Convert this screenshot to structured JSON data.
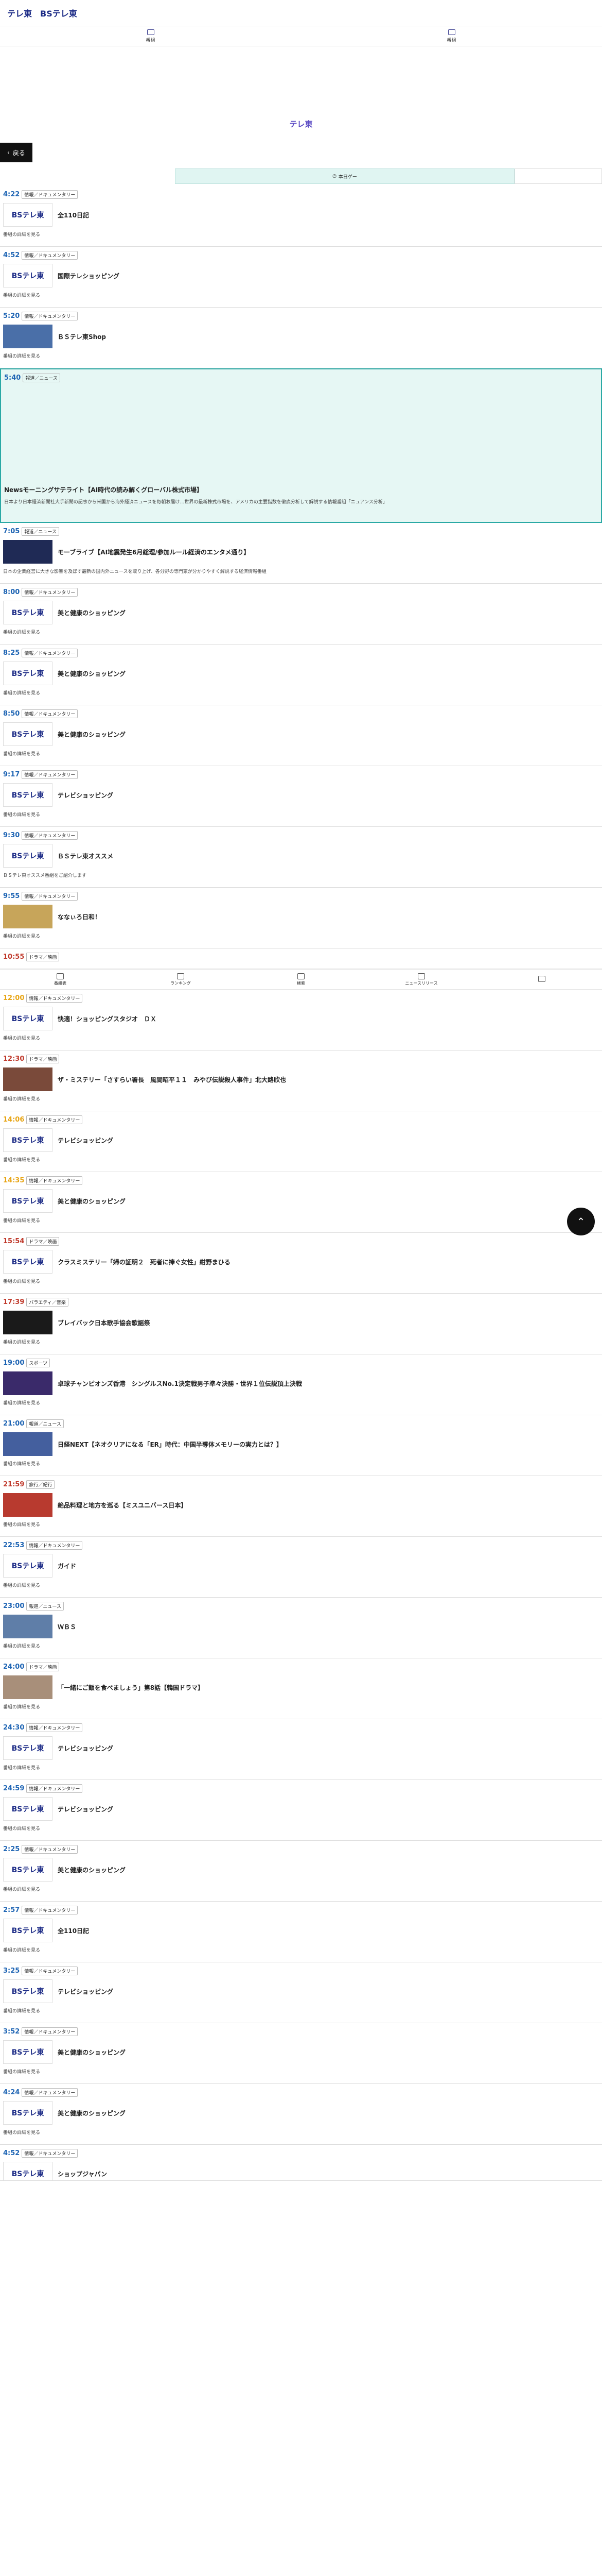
{
  "header": {
    "logo1": "テレ東",
    "logo2": "BSテレ東"
  },
  "nav": [
    {
      "label": "番組"
    },
    {
      "label": "番組"
    }
  ],
  "channel_logo": "テレ東",
  "back_label": "戻る",
  "tab_label": "本日ゲー",
  "bottom_nav": [
    {
      "label": "番組表"
    },
    {
      "label": "ランキング"
    },
    {
      "label": "検索"
    },
    {
      "label": "ニュースリリース"
    },
    {
      "label": ""
    }
  ],
  "programs": [
    {
      "time": "4:22",
      "genre": "情報／ドキュメンタリー",
      "thumb": "BSテレ東",
      "title": "全110日記",
      "desc": "番組の詳細を見る",
      "cls": "b"
    },
    {
      "time": "4:52",
      "genre": "情報／ドキュメンタリー",
      "thumb": "BSテレ東",
      "title": "国際テレショッピング",
      "desc": "番組の詳細を見る",
      "cls": "b"
    },
    {
      "time": "5:20",
      "genre": "情報／ドキュメンタリー",
      "thumb": "",
      "title": "ＢＳテレ東Shop",
      "desc": "番組の詳細を見る",
      "cls": "b",
      "img": "#4a6fa8"
    },
    {
      "time": "5:40",
      "genre": "報道／ニュース",
      "thumb": "",
      "title": "Newsモーニングサテライト【AI時代の読み解くグローバル株式市場】",
      "desc": "日本より日本経済新聞社大手新聞の記事から米国から海外経済ニュースを毎朝お届け…世界の最新株式市場を、アメリカの主要指数を徹底分析して解説する情報番組「ニュアンス分析」",
      "cls": "b",
      "live": true
    },
    {
      "time": "7:05",
      "genre": "報道／ニュース",
      "thumb": "",
      "title": "モーブライブ【AI地震発生6月総理/参加ルール経済のエンタメ通り】",
      "desc": "日本の企業経営に大きな影響を及ぼす最新の国内外ニュースを取り上げ、各分野の専門家が分かりやすく解説する経済情報番組",
      "cls": "b",
      "img": "#1f2a55"
    },
    {
      "time": "8:00",
      "genre": "情報／ドキュメンタリー",
      "thumb": "BSテレ東",
      "title": "美と健康のショッピング",
      "desc": "番組の詳細を見る",
      "cls": "b"
    },
    {
      "time": "8:25",
      "genre": "情報／ドキュメンタリー",
      "thumb": "BSテレ東",
      "title": "美と健康のショッピング",
      "desc": "番組の詳細を見る",
      "cls": "b"
    },
    {
      "time": "8:50",
      "genre": "情報／ドキュメンタリー",
      "thumb": "BSテレ東",
      "title": "美と健康のショッピング",
      "desc": "番組の詳細を見る",
      "cls": "b"
    },
    {
      "time": "9:17",
      "genre": "情報／ドキュメンタリー",
      "thumb": "BSテレ東",
      "title": "テレビショッピング",
      "desc": "番組の詳細を見る",
      "cls": "b"
    },
    {
      "time": "9:30",
      "genre": "情報／ドキュメンタリー",
      "thumb": "BSテレ東",
      "title": "ＢＳテレ東オススメ",
      "desc": "ＢＳテレ東オススメ番組をご紹介します",
      "cls": "b"
    },
    {
      "time": "9:55",
      "genre": "情報／ドキュメンタリー",
      "thumb": "",
      "title": "ななぃろ日和！",
      "desc": "番組の詳細を見る",
      "cls": "b",
      "img": "#c7a55a"
    },
    {
      "time": "10:55",
      "genre": "ドラマ／映画",
      "thumb": "",
      "title": "",
      "desc": "",
      "cls": "p",
      "nothumb": true
    },
    {
      "time": "12:00",
      "genre": "情報／ドキュメンタリー",
      "thumb": "BSテレ東",
      "title": "快適！ショッピングスタジオ　ＤＸ",
      "desc": "番組の詳細を見る",
      "cls": ""
    },
    {
      "time": "12:30",
      "genre": "ドラマ／映画",
      "thumb": "",
      "title": "ザ・ミステリー「さすらい署長　風間昭平１１　みやび伝説殺人事件」北大路欣也",
      "desc": "番組の詳細を見る",
      "cls": "p",
      "img": "#7a4a3a"
    },
    {
      "time": "14:06",
      "genre": "情報／ドキュメンタリー",
      "thumb": "BSテレ東",
      "title": "テレビショッピング",
      "desc": "番組の詳細を見る",
      "cls": ""
    },
    {
      "time": "14:35",
      "genre": "情報／ドキュメンタリー",
      "thumb": "BSテレ東",
      "title": "美と健康のショッピング",
      "desc": "番組の詳細を見る",
      "cls": ""
    },
    {
      "time": "15:54",
      "genre": "ドラマ／映画",
      "thumb": "BSテレ東",
      "title": "クラスミステリー「婦の証明２　死者に捧ぐ女性」紺野まひる",
      "desc": "番組の詳細を見る",
      "cls": "p"
    },
    {
      "time": "17:39",
      "genre": "バラエティ／音楽",
      "thumb": "",
      "title": "ブレイバック日本歌手協会歌謡祭",
      "desc": "番組の詳細を見る",
      "cls": "p",
      "img": "#1a1a1a"
    },
    {
      "time": "19:00",
      "genre": "スポーツ",
      "thumb": "",
      "title": "卓球チャンピオンズ香港　シングルスNo.1決定戦男子準々決勝・世界１位伝説頂上決戦",
      "desc": "番組の詳細を見る",
      "cls": "b",
      "img": "#3a2a6a"
    },
    {
      "time": "21:00",
      "genre": "報道／ニュース",
      "thumb": "",
      "title": "日経NEXT【ネオクリアになる「ER」時代：中国半導体メモリーの実力とは？】",
      "desc": "番組の詳細を見る",
      "cls": "b",
      "img": "#445f9e"
    },
    {
      "time": "21:59",
      "genre": "旅行／紀行",
      "thumb": "",
      "title": "絶品料理と地方を巡る【ミスユニバース日本】",
      "desc": "番組の詳細を見る",
      "cls": "p",
      "img": "#b83a2f"
    },
    {
      "time": "22:53",
      "genre": "情報／ドキュメンタリー",
      "thumb": "BSテレ東",
      "title": "ガイド",
      "desc": "番組の詳細を見る",
      "cls": "b"
    },
    {
      "time": "23:00",
      "genre": "報道／ニュース",
      "thumb": "",
      "title": "ＷＢＳ",
      "desc": "番組の詳細を見る",
      "cls": "b",
      "img": "#5f7ea8"
    },
    {
      "time": "24:00",
      "genre": "ドラマ／映画",
      "thumb": "",
      "title": "「一緒にご飯を食べましょう」第8話【韓国ドラマ】",
      "desc": "番組の詳細を見る",
      "cls": "b",
      "img": "#a88f7a"
    },
    {
      "time": "24:30",
      "genre": "情報／ドキュメンタリー",
      "thumb": "BSテレ東",
      "title": "テレビショッピング",
      "desc": "番組の詳細を見る",
      "cls": "b"
    },
    {
      "time": "24:59",
      "genre": "情報／ドキュメンタリー",
      "thumb": "BSテレ東",
      "title": "テレビショッピング",
      "desc": "番組の詳細を見る",
      "cls": "b"
    },
    {
      "time": "2:25",
      "genre": "情報／ドキュメンタリー",
      "thumb": "BSテレ東",
      "title": "美と健康のショッピング",
      "desc": "番組の詳細を見る",
      "cls": "b"
    },
    {
      "time": "2:57",
      "genre": "情報／ドキュメンタリー",
      "thumb": "BSテレ東",
      "title": "全110日記",
      "desc": "番組の詳細を見る",
      "cls": "b"
    },
    {
      "time": "3:25",
      "genre": "情報／ドキュメンタリー",
      "thumb": "BSテレ東",
      "title": "テレビショッピング",
      "desc": "番組の詳細を見る",
      "cls": "b"
    },
    {
      "time": "3:52",
      "genre": "情報／ドキュメンタリー",
      "thumb": "BSテレ東",
      "title": "美と健康のショッピング",
      "desc": "番組の詳細を見る",
      "cls": "b"
    },
    {
      "time": "4:24",
      "genre": "情報／ドキュメンタリー",
      "thumb": "BSテレ東",
      "title": "美と健康のショッピング",
      "desc": "番組の詳細を見る",
      "cls": "b"
    },
    {
      "time": "4:52",
      "genre": "情報／ドキュメンタリー",
      "thumb": "BSテレ東",
      "title": "ショップジャパン",
      "desc": "",
      "cls": "b"
    }
  ]
}
